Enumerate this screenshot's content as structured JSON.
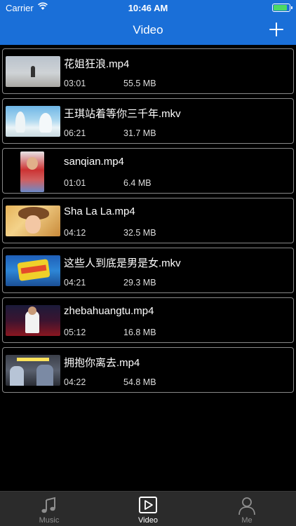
{
  "status_bar": {
    "carrier": "Carrier",
    "time": "10:46 AM"
  },
  "nav": {
    "title": "Video"
  },
  "videos": [
    {
      "name": "花姐狂浪.mp4",
      "duration": "03:01",
      "size": "55.5 MB"
    },
    {
      "name": "王琪站着等你三千年.mkv",
      "duration": "06:21",
      "size": "31.7 MB"
    },
    {
      "name": "sanqian.mp4",
      "duration": "01:01",
      "size": "6.4 MB"
    },
    {
      "name": "Sha La La.mp4",
      "duration": "04:12",
      "size": "32.5 MB"
    },
    {
      "name": "这些人到底是男是女.mkv",
      "duration": "04:21",
      "size": "29.3 MB"
    },
    {
      "name": "zhebahuangtu.mp4",
      "duration": "05:12",
      "size": "16.8 MB"
    },
    {
      "name": "拥抱你离去.mp4",
      "duration": "04:22",
      "size": "54.8 MB"
    }
  ],
  "tabbar": {
    "tabs": [
      {
        "label": "Music",
        "icon": "music-note-icon"
      },
      {
        "label": "Video",
        "icon": "play-icon",
        "active": true
      },
      {
        "label": "Me",
        "icon": "person-icon"
      }
    ]
  },
  "colors": {
    "nav_bg": "#1a6fd8",
    "tabbar_bg": "#2b2b2b",
    "battery": "#4cd964"
  }
}
